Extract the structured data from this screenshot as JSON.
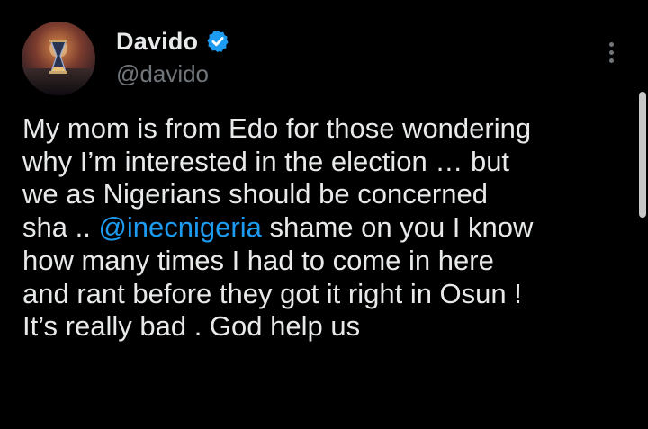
{
  "author": {
    "display_name": "Davido",
    "handle": "@davido",
    "verified": true,
    "avatar_icon": "profile-avatar-hourglass"
  },
  "more_icon": "more-vertical-icon",
  "tweet": {
    "lines": [
      {
        "text": "My mom is from Edo for those wondering"
      },
      {
        "text": "why I’m interested in the election … but"
      },
      {
        "text": "we as Nigerians should be concerned"
      },
      {
        "before": "sha .. ",
        "mention": "@inecnigeria",
        "after": " shame on you I know"
      },
      {
        "text": "how many times I had to come in here"
      },
      {
        "text": "and rant before they got it right in Osun !"
      },
      {
        "text": "It’s really bad . God help us"
      }
    ]
  },
  "colors": {
    "background": "#000000",
    "text": "#e7e9ea",
    "secondary_text": "#71767b",
    "accent": "#1d9bf0"
  }
}
